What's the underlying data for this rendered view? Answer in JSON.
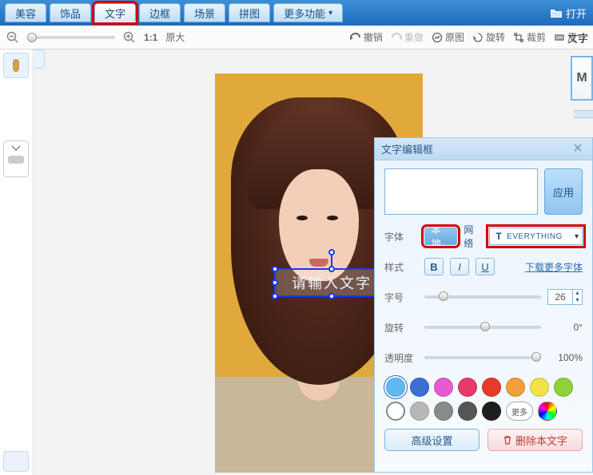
{
  "tabs": {
    "beauty": "美容",
    "deco": "饰品",
    "text": "文字",
    "border": "边框",
    "scene": "场景",
    "collage": "拼图",
    "more": "更多功能"
  },
  "open_label": "打开",
  "toolbar": {
    "ratio": "1:1",
    "original_size": "原大",
    "undo": "撤销",
    "redo": "重做",
    "original_image": "原图",
    "rotate": "旋转",
    "crop": "裁剪",
    "dimensions": "尺寸"
  },
  "right_tab": "文字",
  "preview_letter": "M",
  "canvas": {
    "text_placeholder": "请输入文字"
  },
  "panel": {
    "title": "文字编辑框",
    "apply": "应用",
    "font_label": "字体",
    "font_source_local": "本地",
    "font_source_network": "网络",
    "font_name": "EVERYTHING",
    "style_label": "样式",
    "bold": "B",
    "italic": "I",
    "underline": "U",
    "more_fonts": "下载更多字体",
    "size_label": "字号",
    "size_value": "26",
    "rotate_label": "旋转",
    "rotate_value": "0°",
    "opacity_label": "透明度",
    "opacity_value": "100%",
    "more_color": "更多",
    "advanced": "高级设置",
    "delete": "删除本文字"
  },
  "colors_row1": [
    "#5fb9f3",
    "#3b6fd4",
    "#e65bd1",
    "#e53a6b",
    "#e23c2a",
    "#f2a038",
    "#f4e14a"
  ],
  "colors_row2": [
    "#8fd13a",
    "hollow",
    "#b7b7b7",
    "#8a8a8a",
    "#565656",
    "#1e1e1e"
  ]
}
